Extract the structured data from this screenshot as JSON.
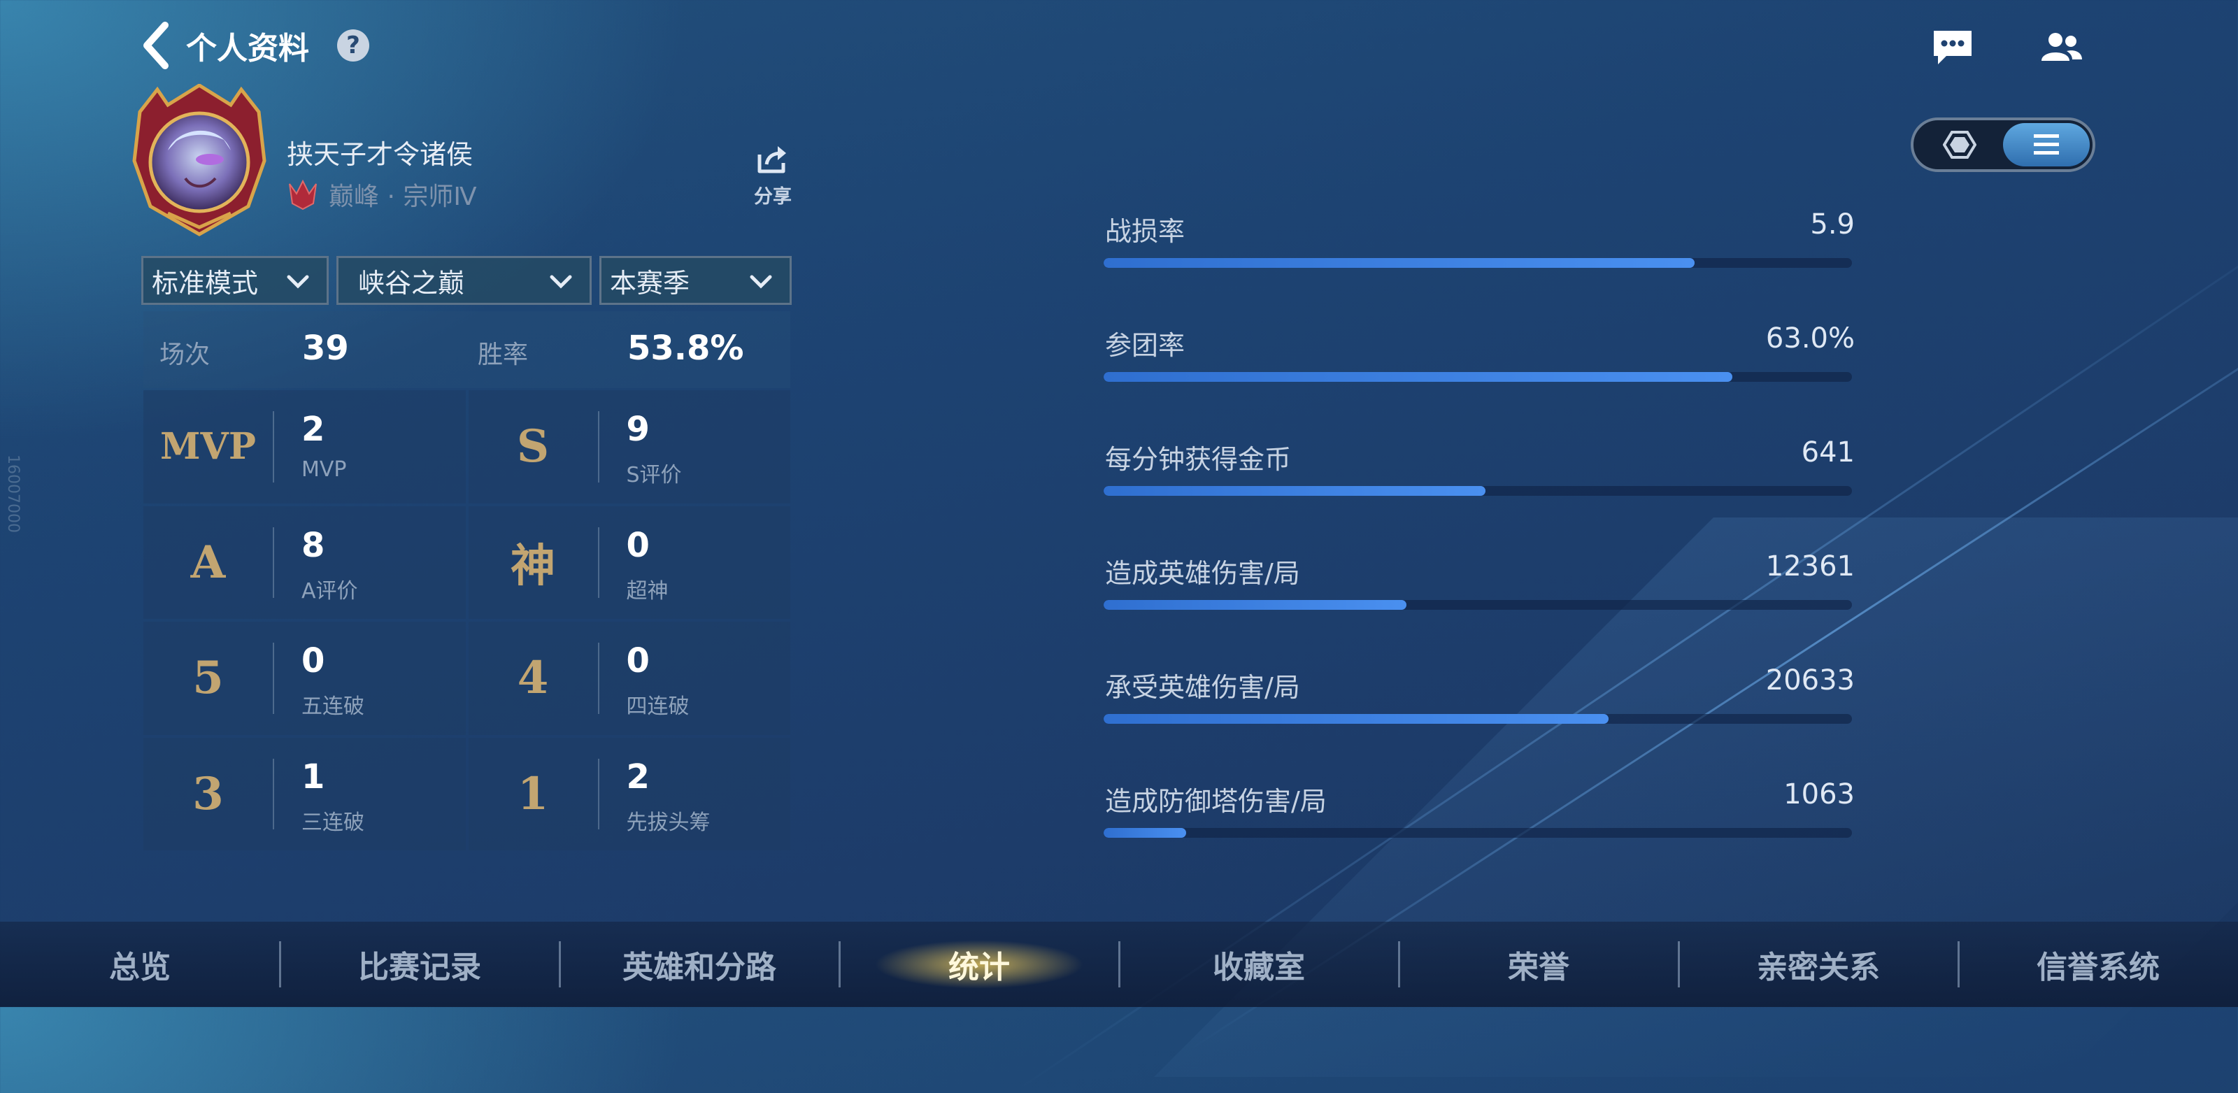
{
  "header": {
    "title": "个人资料",
    "help": "?"
  },
  "profile": {
    "username": "挟天子才令诸侯",
    "rank": "巅峰 · 宗师Ⅳ",
    "share_label": "分享"
  },
  "filters": [
    {
      "label": "标准模式"
    },
    {
      "label": "峡谷之巅"
    },
    {
      "label": "本赛季"
    }
  ],
  "summary": {
    "matches_label": "场次",
    "matches_value": "39",
    "winrate_label": "胜率",
    "winrate_value": "53.8%"
  },
  "grid": [
    {
      "badge": "MVP",
      "value": "2",
      "label": "MVP"
    },
    {
      "badge": "S",
      "value": "9",
      "label": "S评价"
    },
    {
      "badge": "A",
      "value": "8",
      "label": "A评价"
    },
    {
      "badge": "神",
      "value": "0",
      "label": "超神"
    },
    {
      "badge": "5",
      "value": "0",
      "label": "五连破"
    },
    {
      "badge": "4",
      "value": "0",
      "label": "四连破"
    },
    {
      "badge": "3",
      "value": "1",
      "label": "三连破"
    },
    {
      "badge": "1",
      "value": "2",
      "label": "先拔头筹"
    }
  ],
  "stats": [
    {
      "label": "战损率",
      "value": "5.9",
      "fill": 0.79
    },
    {
      "label": "参团率",
      "value": "63.0%",
      "fill": 0.84
    },
    {
      "label": "每分钟获得金币",
      "value": "641",
      "fill": 0.51
    },
    {
      "label": "造成英雄伤害/局",
      "value": "12361",
      "fill": 0.405
    },
    {
      "label": "承受英雄伤害/局",
      "value": "20633",
      "fill": 0.675
    },
    {
      "label": "造成防御塔伤害/局",
      "value": "1063",
      "fill": 0.11
    }
  ],
  "tabs": [
    {
      "label": "总览"
    },
    {
      "label": "比赛记录"
    },
    {
      "label": "英雄和分路"
    },
    {
      "label": "统计",
      "active": true
    },
    {
      "label": "收藏室"
    },
    {
      "label": "荣誉"
    },
    {
      "label": "亲密关系"
    },
    {
      "label": "信誉系统"
    }
  ],
  "side_text": "16007000",
  "colors": {
    "accent": "#4a90f0",
    "gold": "#c2a571",
    "active_tab_glow": "#dcbe5a"
  }
}
